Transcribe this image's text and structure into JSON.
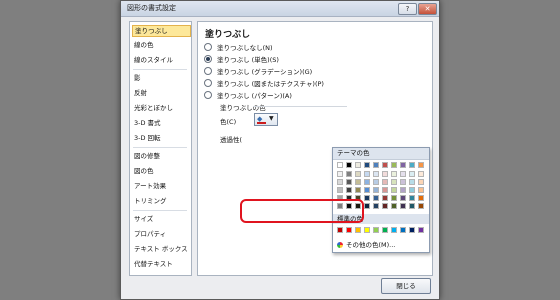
{
  "window": {
    "title": "図形の書式設定",
    "help_icon": "?",
    "close_icon": "✕"
  },
  "sidebar": {
    "items": [
      {
        "label": "塗りつぶし",
        "active": true
      },
      {
        "label": "線の色"
      },
      {
        "label": "線のスタイル"
      },
      {
        "label": "影"
      },
      {
        "label": "反射"
      },
      {
        "label": "光彩とぼかし"
      },
      {
        "label": "3-D 書式"
      },
      {
        "label": "3-D 回転"
      },
      {
        "label": "図の修整"
      },
      {
        "label": "図の色"
      },
      {
        "label": "アート効果"
      },
      {
        "label": "トリミング"
      },
      {
        "label": "サイズ"
      },
      {
        "label": "プロパティ"
      },
      {
        "label": "テキスト ボックス"
      },
      {
        "label": "代替テキスト"
      }
    ]
  },
  "fill": {
    "title": "塗りつぶし",
    "options": [
      {
        "label": "塗りつぶしなし(N)",
        "selected": false
      },
      {
        "label": "塗りつぶし (単色)(S)",
        "selected": true
      },
      {
        "label": "塗りつぶし (グラデーション)(G)",
        "selected": false
      },
      {
        "label": "塗りつぶし (図またはテクスチャ)(P)",
        "selected": false
      },
      {
        "label": "塗りつぶし (パターン)(A)",
        "selected": false
      }
    ],
    "color_group_label": "塗りつぶしの色",
    "color_label": "色(C)",
    "transparency_label": "透過性(",
    "current_color": "#cc1d1d"
  },
  "color_dropdown": {
    "theme_header": "テーマの色",
    "theme_colors": [
      "#ffffff",
      "#000000",
      "#eeece1",
      "#1f497d",
      "#4f81bd",
      "#c0504d",
      "#9bbb59",
      "#8064a2",
      "#4bacc6",
      "#f79646"
    ],
    "theme_shades": [
      [
        "#f2f2f2",
        "#7f7f7f",
        "#ddd9c3",
        "#c6d9f0",
        "#dbe5f1",
        "#f2dcdb",
        "#ebf1dd",
        "#e5e0ec",
        "#dbeef3",
        "#fdeada"
      ],
      [
        "#d8d8d8",
        "#595959",
        "#c4bd97",
        "#8db3e2",
        "#b8cce4",
        "#e5b9b7",
        "#d7e3bc",
        "#ccc1d9",
        "#b7dde8",
        "#fbd5b5"
      ],
      [
        "#bfbfbf",
        "#3f3f3f",
        "#938953",
        "#548dd4",
        "#95b3d7",
        "#d99694",
        "#c3d69b",
        "#b2a2c7",
        "#92cddc",
        "#fac08f"
      ],
      [
        "#a5a5a5",
        "#262626",
        "#494429",
        "#17365d",
        "#366092",
        "#953734",
        "#76923c",
        "#5f497a",
        "#31859b",
        "#e36c09"
      ],
      [
        "#7f7f7f",
        "#0c0c0c",
        "#1d1b10",
        "#0f243e",
        "#244061",
        "#632423",
        "#4f6128",
        "#3f3151",
        "#205867",
        "#974806"
      ]
    ],
    "standard_header": "標準の色",
    "standard_colors": [
      "#c00000",
      "#ff0000",
      "#ffc000",
      "#ffff00",
      "#92d050",
      "#00b050",
      "#00b0f0",
      "#0070c0",
      "#002060",
      "#7030a0"
    ],
    "more_colors_label": "その他の色(M)..."
  },
  "highlight_color": "#e0141f",
  "close_button_label": "閉じる"
}
